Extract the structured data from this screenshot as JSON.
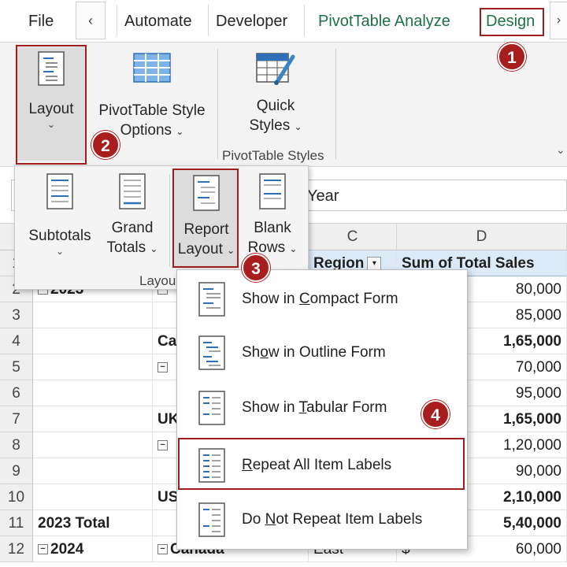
{
  "tabs": {
    "file": "File",
    "scroll_left": "‹",
    "automate": "Automate",
    "developer": "Developer",
    "pivot_analyze": "PivotTable Analyze",
    "design": "Design",
    "scroll_right": "›"
  },
  "ribbon": {
    "layout_label": "Layout",
    "style_options_line1": "PivotTable Style",
    "style_options_line2": "Options",
    "quick_styles_line1": "Quick",
    "quick_styles_line2": "Styles",
    "styles_group_label": "PivotTable Styles",
    "caret": "⌄"
  },
  "layout_panel": {
    "subtotals": "Subtotals",
    "grand_line1": "Grand",
    "grand_line2": "Totals",
    "report_line1": "Report",
    "report_line2": "Layout",
    "blank_line1": "Blank",
    "blank_line2": "Rows",
    "group_label": "Layou"
  },
  "formula_bar": {
    "value": "Year"
  },
  "grid": {
    "columns": [
      "C",
      "D"
    ],
    "header_region": "Region",
    "header_sales": "Sum of Total Sales",
    "rows": [
      {
        "n": "1"
      },
      {
        "n": "2",
        "a": "2023",
        "d": "80,000"
      },
      {
        "n": "3",
        "d": "85,000"
      },
      {
        "n": "4",
        "b": "Ca",
        "d": "1,65,000"
      },
      {
        "n": "5",
        "d": "70,000"
      },
      {
        "n": "6",
        "d": "95,000"
      },
      {
        "n": "7",
        "b": "UK",
        "d": "1,65,000"
      },
      {
        "n": "8",
        "d": "1,20,000"
      },
      {
        "n": "9",
        "d": "90,000"
      },
      {
        "n": "10",
        "b": "US",
        "d": "2,10,000"
      },
      {
        "n": "11",
        "a": "2023 Total",
        "d": "5,40,000"
      },
      {
        "n": "12",
        "a": "2024",
        "b": "Canada",
        "c": "East",
        "d_prefix": "$",
        "d": "60,000"
      }
    ]
  },
  "report_menu": {
    "items": [
      {
        "pre": "Show in ",
        "key": "C",
        "post": "ompact Form"
      },
      {
        "pre": "Sh",
        "key": "o",
        "post": "w in Outline Form"
      },
      {
        "pre": "Show in ",
        "key": "T",
        "post": "abular Form"
      },
      {
        "pre": "",
        "key": "R",
        "post": "epeat All Item Labels"
      },
      {
        "pre": "Do ",
        "key": "N",
        "post": "ot Repeat Item Labels"
      }
    ]
  },
  "badges": [
    "1",
    "2",
    "3",
    "4"
  ],
  "colors": {
    "highlight": "#a01d1d",
    "badge": "#a81d1d",
    "pivot_tab": "#1e7145",
    "header_fill": "#dce9f7"
  }
}
